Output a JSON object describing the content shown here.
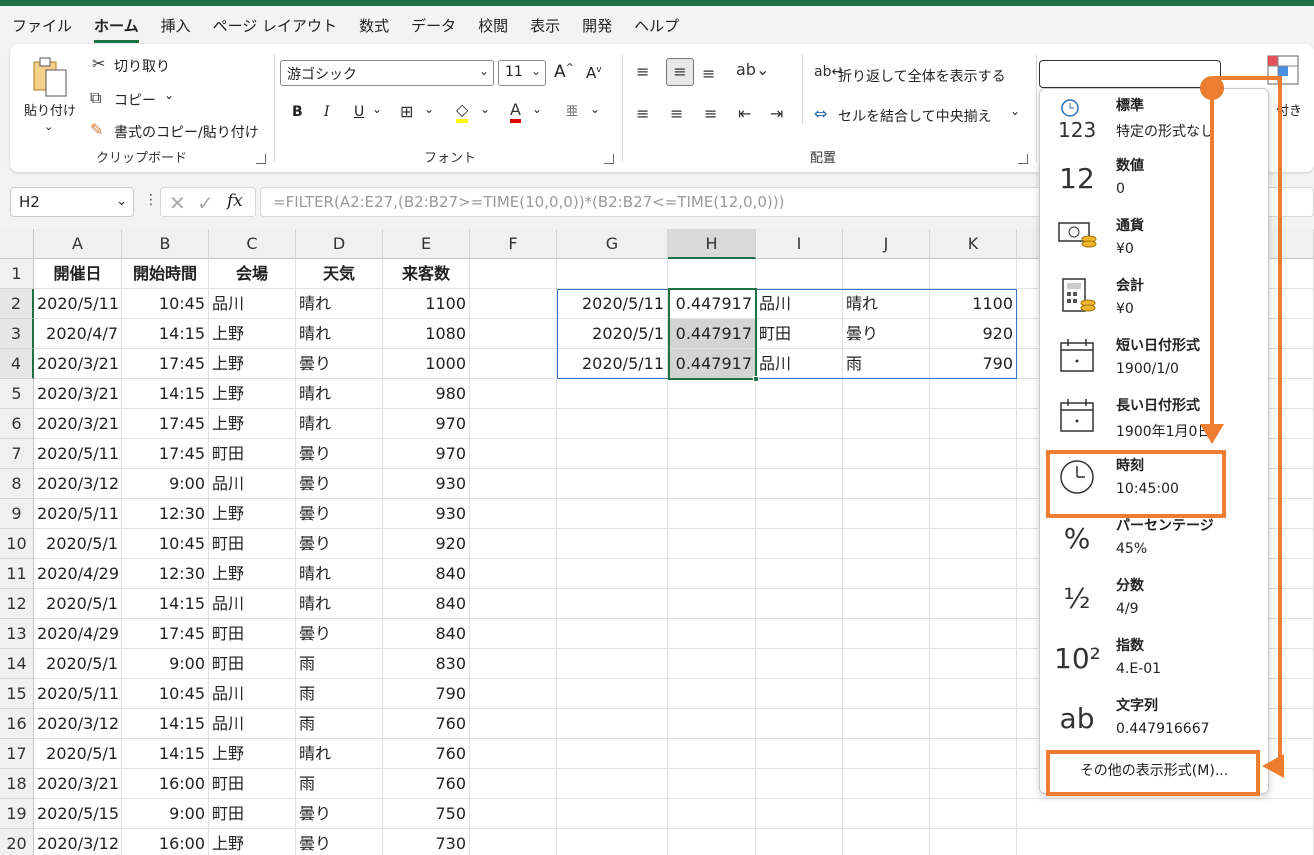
{
  "menu": {
    "tabs": [
      "ファイル",
      "ホーム",
      "挿入",
      "ページ レイアウト",
      "数式",
      "データ",
      "校閲",
      "表示",
      "開発",
      "ヘルプ"
    ],
    "active": "ホーム"
  },
  "ribbon": {
    "clipboard": {
      "paste": "貼り付け",
      "cut": "切り取り",
      "copy": "コピー",
      "format_painter": "書式のコピー/貼り付け",
      "label": "クリップボード"
    },
    "font": {
      "family": "游ゴシック",
      "size": "11",
      "label": "フォント",
      "grow": "A",
      "shrink": "A",
      "bold": "B",
      "italic": "I",
      "underline": "U"
    },
    "alignment": {
      "wrap_text": "折り返して全体を表示する",
      "merge_center": "セルを結合して中央揃え",
      "label": "配置"
    },
    "number": {
      "format_value": ""
    },
    "partial_right": "付き"
  },
  "formula_bar": {
    "name_box": "H2",
    "fx": "fx",
    "formula": "=FILTER(A2:E27,(B2:B27>=TIME(10,0,0))*(B2:B27<=TIME(12,0,0)))"
  },
  "sheet": {
    "columns": [
      "A",
      "B",
      "C",
      "D",
      "E",
      "F",
      "G",
      "H",
      "I",
      "J",
      "K"
    ],
    "selected_column": "H",
    "header_row": [
      "開催日",
      "開始時間",
      "会場",
      "天気",
      "来客数"
    ],
    "rows": [
      [
        "2020/5/11",
        "10:45",
        "品川",
        "晴れ",
        "1100"
      ],
      [
        "2020/4/7",
        "14:15",
        "上野",
        "晴れ",
        "1080"
      ],
      [
        "2020/3/21",
        "17:45",
        "上野",
        "曇り",
        "1000"
      ],
      [
        "2020/3/21",
        "14:15",
        "上野",
        "晴れ",
        "980"
      ],
      [
        "2020/3/21",
        "17:45",
        "上野",
        "晴れ",
        "970"
      ],
      [
        "2020/5/11",
        "17:45",
        "町田",
        "曇り",
        "970"
      ],
      [
        "2020/3/12",
        "9:00",
        "品川",
        "曇り",
        "930"
      ],
      [
        "2020/5/11",
        "12:30",
        "上野",
        "曇り",
        "930"
      ],
      [
        "2020/5/1",
        "10:45",
        "町田",
        "曇り",
        "920"
      ],
      [
        "2020/4/29",
        "12:30",
        "上野",
        "晴れ",
        "840"
      ],
      [
        "2020/5/1",
        "14:15",
        "品川",
        "晴れ",
        "840"
      ],
      [
        "2020/4/29",
        "17:45",
        "町田",
        "曇り",
        "840"
      ],
      [
        "2020/5/1",
        "9:00",
        "町田",
        "雨",
        "830"
      ],
      [
        "2020/5/11",
        "10:45",
        "品川",
        "雨",
        "790"
      ],
      [
        "2020/3/12",
        "14:15",
        "品川",
        "雨",
        "760"
      ],
      [
        "2020/5/1",
        "14:15",
        "上野",
        "晴れ",
        "760"
      ],
      [
        "2020/3/21",
        "16:00",
        "町田",
        "雨",
        "760"
      ],
      [
        "2020/5/15",
        "9:00",
        "町田",
        "曇り",
        "750"
      ],
      [
        "2020/3/12",
        "16:00",
        "上野",
        "曇り",
        "730"
      ]
    ],
    "row_numbers": [
      "1",
      "2",
      "3",
      "4",
      "5",
      "6",
      "7",
      "8",
      "9",
      "10",
      "11",
      "12",
      "13",
      "14",
      "15",
      "16",
      "17",
      "18",
      "19",
      "20"
    ],
    "filter_results": [
      [
        "2020/5/11",
        "0.447917",
        "品川",
        "晴れ",
        "1100"
      ],
      [
        "2020/5/1",
        "0.447917",
        "町田",
        "曇り",
        "920"
      ],
      [
        "2020/5/11",
        "0.447917",
        "品川",
        "雨",
        "790"
      ]
    ]
  },
  "number_format_menu": {
    "items": [
      {
        "icon": "123",
        "name": "標準",
        "sample": "特定の形式なし"
      },
      {
        "icon": "12",
        "name": "数値",
        "sample": "0"
      },
      {
        "icon": "currency",
        "name": "通貨",
        "sample": "¥0"
      },
      {
        "icon": "calculator",
        "name": "会計",
        "sample": " ¥0"
      },
      {
        "icon": "calendar",
        "name": "短い日付形式",
        "sample": "1900/1/0"
      },
      {
        "icon": "calendar",
        "name": "長い日付形式",
        "sample": "1900年1月0日"
      },
      {
        "icon": "clock",
        "name": "時刻",
        "sample": "10:45:00"
      },
      {
        "icon": "%",
        "name": "パーセンテージ",
        "sample": "45%"
      },
      {
        "icon": "½",
        "name": "分数",
        "sample": " 4/9"
      },
      {
        "icon": "10²",
        "name": "指数",
        "sample": "4.E-01"
      },
      {
        "icon": "ab",
        "name": "文字列",
        "sample": "0.447916667"
      }
    ],
    "more": "その他の表示形式(M)..."
  },
  "colors": {
    "accent_green": "#1f7145",
    "annotation_orange": "#ed7d31",
    "selection_blue": "#3b73c4"
  }
}
